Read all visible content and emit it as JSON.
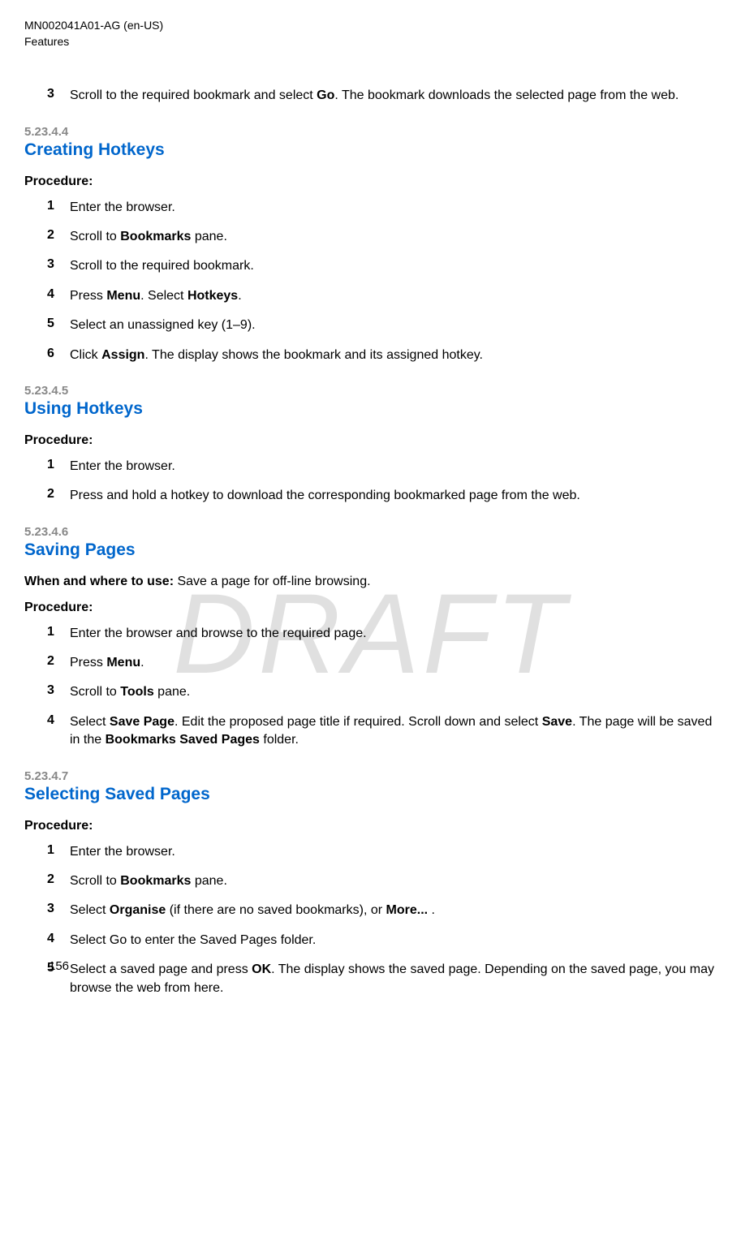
{
  "header": {
    "doc_id": "MN002041A01-AG (en-US)",
    "section": "Features"
  },
  "watermark": "DRAFT",
  "intro_step": {
    "num": "3",
    "pre": "Scroll to the required bookmark and select ",
    "bold1": "Go",
    "post": ". The bookmark downloads the selected page from the web."
  },
  "s1": {
    "num": "5.23.4.4",
    "title": "Creating Hotkeys",
    "procedure": "Procedure:",
    "steps": [
      {
        "num": "1",
        "parts": [
          {
            "t": "Enter the browser."
          }
        ]
      },
      {
        "num": "2",
        "parts": [
          {
            "t": "Scroll to "
          },
          {
            "b": "Bookmarks"
          },
          {
            "t": " pane."
          }
        ]
      },
      {
        "num": "3",
        "parts": [
          {
            "t": "Scroll to the required bookmark."
          }
        ]
      },
      {
        "num": "4",
        "parts": [
          {
            "t": "Press "
          },
          {
            "b": "Menu"
          },
          {
            "t": ". Select "
          },
          {
            "b": "Hotkeys"
          },
          {
            "t": "."
          }
        ]
      },
      {
        "num": "5",
        "parts": [
          {
            "t": "Select an unassigned key (1–9)."
          }
        ]
      },
      {
        "num": "6",
        "parts": [
          {
            "t": "Click "
          },
          {
            "b": "Assign"
          },
          {
            "t": ". The display shows the bookmark and its assigned hotkey."
          }
        ]
      }
    ]
  },
  "s2": {
    "num": "5.23.4.5",
    "title": "Using Hotkeys",
    "procedure": "Procedure:",
    "steps": [
      {
        "num": "1",
        "parts": [
          {
            "t": "Enter the browser."
          }
        ]
      },
      {
        "num": "2",
        "parts": [
          {
            "t": "Press and hold a hotkey to download the corresponding bookmarked page from the web."
          }
        ]
      }
    ]
  },
  "s3": {
    "num": "5.23.4.6",
    "title": "Saving Pages",
    "usage_label": "When and where to use:",
    "usage_text": " Save a page for off-line browsing.",
    "procedure": "Procedure:",
    "steps": [
      {
        "num": "1",
        "parts": [
          {
            "t": "Enter the browser and browse to the required page."
          }
        ]
      },
      {
        "num": "2",
        "parts": [
          {
            "t": "Press "
          },
          {
            "b": "Menu"
          },
          {
            "t": "."
          }
        ]
      },
      {
        "num": "3",
        "parts": [
          {
            "t": "Scroll to "
          },
          {
            "b": "Tools"
          },
          {
            "t": " pane."
          }
        ]
      },
      {
        "num": "4",
        "parts": [
          {
            "t": "Select "
          },
          {
            "b": "Save Page"
          },
          {
            "t": ". Edit the proposed page title if required. Scroll down and select "
          },
          {
            "b": "Save"
          },
          {
            "t": ". The page will be saved in the "
          },
          {
            "b": "Bookmarks Saved Pages"
          },
          {
            "t": " folder."
          }
        ]
      }
    ]
  },
  "s4": {
    "num": "5.23.4.7",
    "title": "Selecting Saved Pages",
    "procedure": "Procedure:",
    "steps": [
      {
        "num": "1",
        "parts": [
          {
            "t": "Enter the browser."
          }
        ]
      },
      {
        "num": "2",
        "parts": [
          {
            "t": "Scroll to "
          },
          {
            "b": "Bookmarks"
          },
          {
            "t": " pane."
          }
        ]
      },
      {
        "num": "3",
        "parts": [
          {
            "t": "Select "
          },
          {
            "b": "Organise"
          },
          {
            "t": " (if there are no saved bookmarks), or "
          },
          {
            "b": "More..."
          },
          {
            "t": " ."
          }
        ]
      },
      {
        "num": "4",
        "parts": [
          {
            "t": "Select Go to enter the Saved Pages folder."
          }
        ]
      },
      {
        "num": "5",
        "parts": [
          {
            "t": "Select a saved page and press "
          },
          {
            "b": "OK"
          },
          {
            "t": ". The display shows the saved page. Depending on the saved page, you may browse the web from here."
          }
        ]
      }
    ]
  },
  "footer": {
    "page_num": "156"
  }
}
